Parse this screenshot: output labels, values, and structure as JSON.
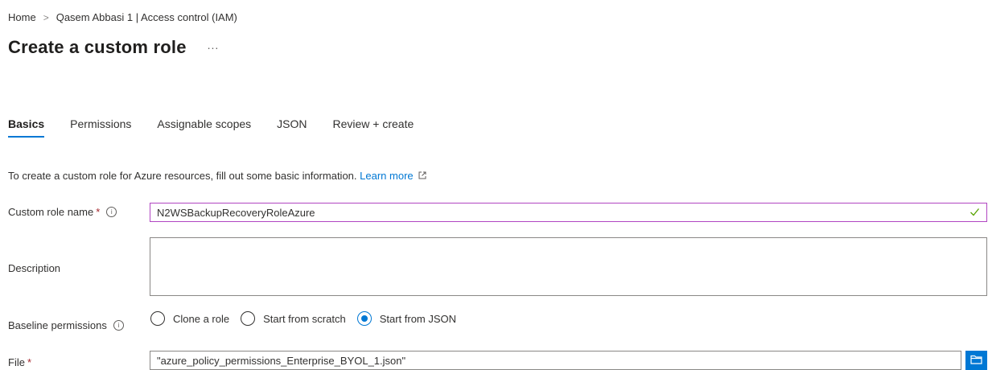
{
  "breadcrumb": {
    "items": [
      "Home",
      "Qasem Abbasi 1 | Access control (IAM)"
    ],
    "separator": ">"
  },
  "page": {
    "title": "Create a custom role",
    "more_label": "..."
  },
  "tabs": [
    {
      "label": "Basics",
      "active": true
    },
    {
      "label": "Permissions",
      "active": false
    },
    {
      "label": "Assignable scopes",
      "active": false
    },
    {
      "label": "JSON",
      "active": false
    },
    {
      "label": "Review + create",
      "active": false
    }
  ],
  "intro": {
    "text": "To create a custom role for Azure resources, fill out some basic information.",
    "link_label": "Learn more"
  },
  "form": {
    "role_name": {
      "label": "Custom role name",
      "required_mark": "*",
      "value": "N2WSBackupRecoveryRoleAzure"
    },
    "description": {
      "label": "Description",
      "value": ""
    },
    "baseline": {
      "label": "Baseline permissions",
      "options": [
        "Clone a role",
        "Start from scratch",
        "Start from JSON"
      ],
      "selected": "Start from JSON"
    },
    "file": {
      "label": "File",
      "required_mark": "*",
      "value": "\"azure_policy_permissions_Enterprise_BYOL_1.json\""
    }
  },
  "colors": {
    "accent": "#0078d4",
    "focus_border": "#b146c2",
    "valid": "#57a300",
    "required": "#a4262c"
  },
  "icons": {
    "more": "ellipsis-icon",
    "info": "info-icon",
    "external": "external-link-icon",
    "valid": "checkmark-icon",
    "browse": "folder-icon"
  }
}
